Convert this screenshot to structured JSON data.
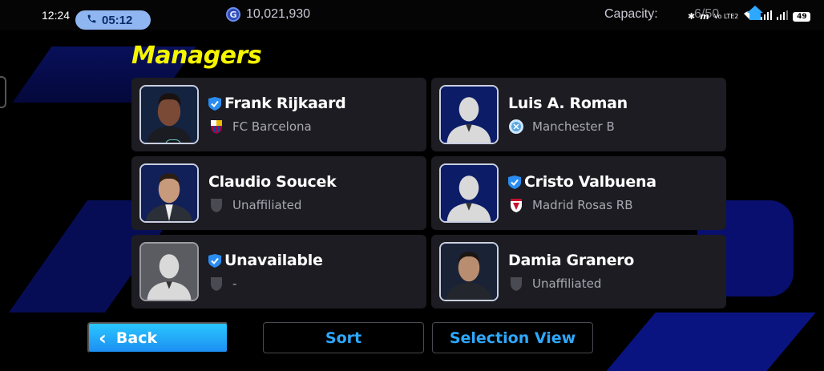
{
  "statusbar": {
    "time": "12:24",
    "call_timer": "05:12",
    "coins": "10,021,930",
    "capacity_label": "Capacity:",
    "capacity_value": "6/50",
    "battery": "49"
  },
  "page": {
    "title": "Managers"
  },
  "managers": [
    {
      "name": "Frank Rijkaard",
      "club": "FC Barcelona",
      "verified": true,
      "portrait": "photo"
    },
    {
      "name": "Luis A. Roman",
      "club": "Manchester B",
      "verified": false,
      "portrait": "silhouette"
    },
    {
      "name": "Claudio Soucek",
      "club": "Unaffiliated",
      "verified": false,
      "portrait": "photo"
    },
    {
      "name": "Cristo Valbuena",
      "club": "Madrid Rosas RB",
      "verified": true,
      "portrait": "silhouette"
    },
    {
      "name": "Unavailable",
      "club": "-",
      "verified": true,
      "portrait": "silhouette-grey"
    },
    {
      "name": "Damia Granero",
      "club": "Unaffiliated",
      "verified": false,
      "portrait": "photo"
    }
  ],
  "buttons": {
    "back": "Back",
    "sort": "Sort",
    "selection_view": "Selection View"
  },
  "colors": {
    "title": "#f5f500",
    "accent": "#2ea8ff",
    "card": "#1c1c22",
    "verified": "#2a8cf0"
  }
}
